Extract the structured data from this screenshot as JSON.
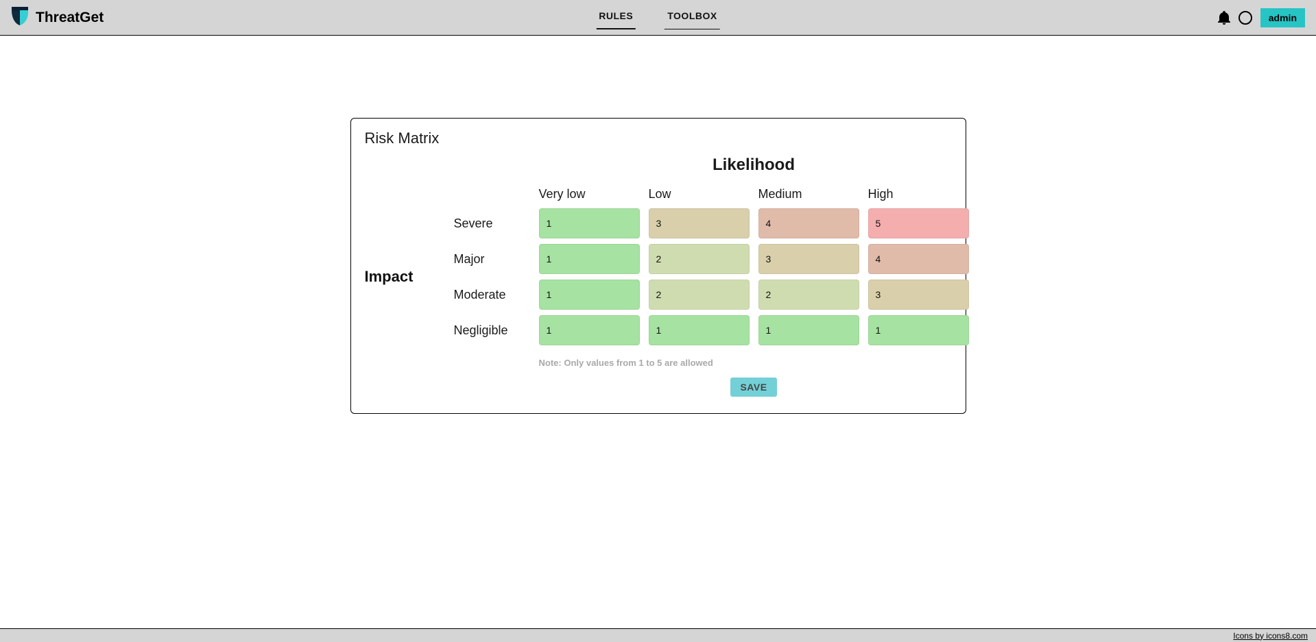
{
  "brand": {
    "name": "ThreatGet"
  },
  "nav": {
    "rules": "RULES",
    "toolbox": "TOOLBOX"
  },
  "user": {
    "name": "admin"
  },
  "card": {
    "title": "Risk Matrix",
    "likelihood_title": "Likelihood",
    "impact_title": "Impact",
    "note": "Note: Only values from 1 to 5 are allowed",
    "save_label": "SAVE",
    "columns": [
      "Very low",
      "Low",
      "Medium",
      "High"
    ],
    "rows": [
      "Severe",
      "Major",
      "Moderate",
      "Negligible"
    ],
    "colors": {
      "1": "#a6e2a1",
      "2": "#cfdcb0",
      "3": "#d9cfab",
      "4": "#e0bbaa",
      "5": "#f4aeae"
    },
    "cells": [
      [
        1,
        3,
        4,
        5
      ],
      [
        1,
        2,
        3,
        4
      ],
      [
        1,
        2,
        2,
        3
      ],
      [
        1,
        1,
        1,
        1
      ]
    ]
  },
  "footer": {
    "credit": "Icons by icons8.com"
  }
}
